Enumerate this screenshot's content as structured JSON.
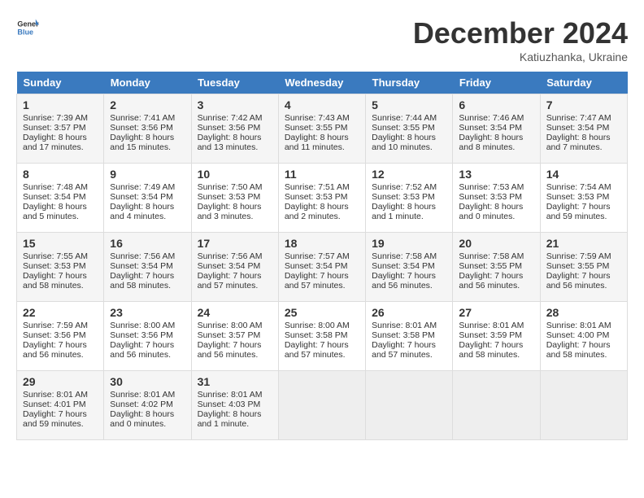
{
  "header": {
    "logo_line1": "General",
    "logo_line2": "Blue",
    "month": "December 2024",
    "location": "Katiuzhanka, Ukraine"
  },
  "days_of_week": [
    "Sunday",
    "Monday",
    "Tuesday",
    "Wednesday",
    "Thursday",
    "Friday",
    "Saturday"
  ],
  "weeks": [
    [
      {
        "day": 1,
        "lines": [
          "Sunrise: 7:39 AM",
          "Sunset: 3:57 PM",
          "Daylight: 8 hours",
          "and 17 minutes."
        ]
      },
      {
        "day": 2,
        "lines": [
          "Sunrise: 7:41 AM",
          "Sunset: 3:56 PM",
          "Daylight: 8 hours",
          "and 15 minutes."
        ]
      },
      {
        "day": 3,
        "lines": [
          "Sunrise: 7:42 AM",
          "Sunset: 3:56 PM",
          "Daylight: 8 hours",
          "and 13 minutes."
        ]
      },
      {
        "day": 4,
        "lines": [
          "Sunrise: 7:43 AM",
          "Sunset: 3:55 PM",
          "Daylight: 8 hours",
          "and 11 minutes."
        ]
      },
      {
        "day": 5,
        "lines": [
          "Sunrise: 7:44 AM",
          "Sunset: 3:55 PM",
          "Daylight: 8 hours",
          "and 10 minutes."
        ]
      },
      {
        "day": 6,
        "lines": [
          "Sunrise: 7:46 AM",
          "Sunset: 3:54 PM",
          "Daylight: 8 hours",
          "and 8 minutes."
        ]
      },
      {
        "day": 7,
        "lines": [
          "Sunrise: 7:47 AM",
          "Sunset: 3:54 PM",
          "Daylight: 8 hours",
          "and 7 minutes."
        ]
      }
    ],
    [
      {
        "day": 8,
        "lines": [
          "Sunrise: 7:48 AM",
          "Sunset: 3:54 PM",
          "Daylight: 8 hours",
          "and 5 minutes."
        ]
      },
      {
        "day": 9,
        "lines": [
          "Sunrise: 7:49 AM",
          "Sunset: 3:54 PM",
          "Daylight: 8 hours",
          "and 4 minutes."
        ]
      },
      {
        "day": 10,
        "lines": [
          "Sunrise: 7:50 AM",
          "Sunset: 3:53 PM",
          "Daylight: 8 hours",
          "and 3 minutes."
        ]
      },
      {
        "day": 11,
        "lines": [
          "Sunrise: 7:51 AM",
          "Sunset: 3:53 PM",
          "Daylight: 8 hours",
          "and 2 minutes."
        ]
      },
      {
        "day": 12,
        "lines": [
          "Sunrise: 7:52 AM",
          "Sunset: 3:53 PM",
          "Daylight: 8 hours",
          "and 1 minute."
        ]
      },
      {
        "day": 13,
        "lines": [
          "Sunrise: 7:53 AM",
          "Sunset: 3:53 PM",
          "Daylight: 8 hours",
          "and 0 minutes."
        ]
      },
      {
        "day": 14,
        "lines": [
          "Sunrise: 7:54 AM",
          "Sunset: 3:53 PM",
          "Daylight: 7 hours",
          "and 59 minutes."
        ]
      }
    ],
    [
      {
        "day": 15,
        "lines": [
          "Sunrise: 7:55 AM",
          "Sunset: 3:53 PM",
          "Daylight: 7 hours",
          "and 58 minutes."
        ]
      },
      {
        "day": 16,
        "lines": [
          "Sunrise: 7:56 AM",
          "Sunset: 3:54 PM",
          "Daylight: 7 hours",
          "and 58 minutes."
        ]
      },
      {
        "day": 17,
        "lines": [
          "Sunrise: 7:56 AM",
          "Sunset: 3:54 PM",
          "Daylight: 7 hours",
          "and 57 minutes."
        ]
      },
      {
        "day": 18,
        "lines": [
          "Sunrise: 7:57 AM",
          "Sunset: 3:54 PM",
          "Daylight: 7 hours",
          "and 57 minutes."
        ]
      },
      {
        "day": 19,
        "lines": [
          "Sunrise: 7:58 AM",
          "Sunset: 3:54 PM",
          "Daylight: 7 hours",
          "and 56 minutes."
        ]
      },
      {
        "day": 20,
        "lines": [
          "Sunrise: 7:58 AM",
          "Sunset: 3:55 PM",
          "Daylight: 7 hours",
          "and 56 minutes."
        ]
      },
      {
        "day": 21,
        "lines": [
          "Sunrise: 7:59 AM",
          "Sunset: 3:55 PM",
          "Daylight: 7 hours",
          "and 56 minutes."
        ]
      }
    ],
    [
      {
        "day": 22,
        "lines": [
          "Sunrise: 7:59 AM",
          "Sunset: 3:56 PM",
          "Daylight: 7 hours",
          "and 56 minutes."
        ]
      },
      {
        "day": 23,
        "lines": [
          "Sunrise: 8:00 AM",
          "Sunset: 3:56 PM",
          "Daylight: 7 hours",
          "and 56 minutes."
        ]
      },
      {
        "day": 24,
        "lines": [
          "Sunrise: 8:00 AM",
          "Sunset: 3:57 PM",
          "Daylight: 7 hours",
          "and 56 minutes."
        ]
      },
      {
        "day": 25,
        "lines": [
          "Sunrise: 8:00 AM",
          "Sunset: 3:58 PM",
          "Daylight: 7 hours",
          "and 57 minutes."
        ]
      },
      {
        "day": 26,
        "lines": [
          "Sunrise: 8:01 AM",
          "Sunset: 3:58 PM",
          "Daylight: 7 hours",
          "and 57 minutes."
        ]
      },
      {
        "day": 27,
        "lines": [
          "Sunrise: 8:01 AM",
          "Sunset: 3:59 PM",
          "Daylight: 7 hours",
          "and 58 minutes."
        ]
      },
      {
        "day": 28,
        "lines": [
          "Sunrise: 8:01 AM",
          "Sunset: 4:00 PM",
          "Daylight: 7 hours",
          "and 58 minutes."
        ]
      }
    ],
    [
      {
        "day": 29,
        "lines": [
          "Sunrise: 8:01 AM",
          "Sunset: 4:01 PM",
          "Daylight: 7 hours",
          "and 59 minutes."
        ]
      },
      {
        "day": 30,
        "lines": [
          "Sunrise: 8:01 AM",
          "Sunset: 4:02 PM",
          "Daylight: 8 hours",
          "and 0 minutes."
        ]
      },
      {
        "day": 31,
        "lines": [
          "Sunrise: 8:01 AM",
          "Sunset: 4:03 PM",
          "Daylight: 8 hours",
          "and 1 minute."
        ]
      },
      null,
      null,
      null,
      null
    ]
  ]
}
